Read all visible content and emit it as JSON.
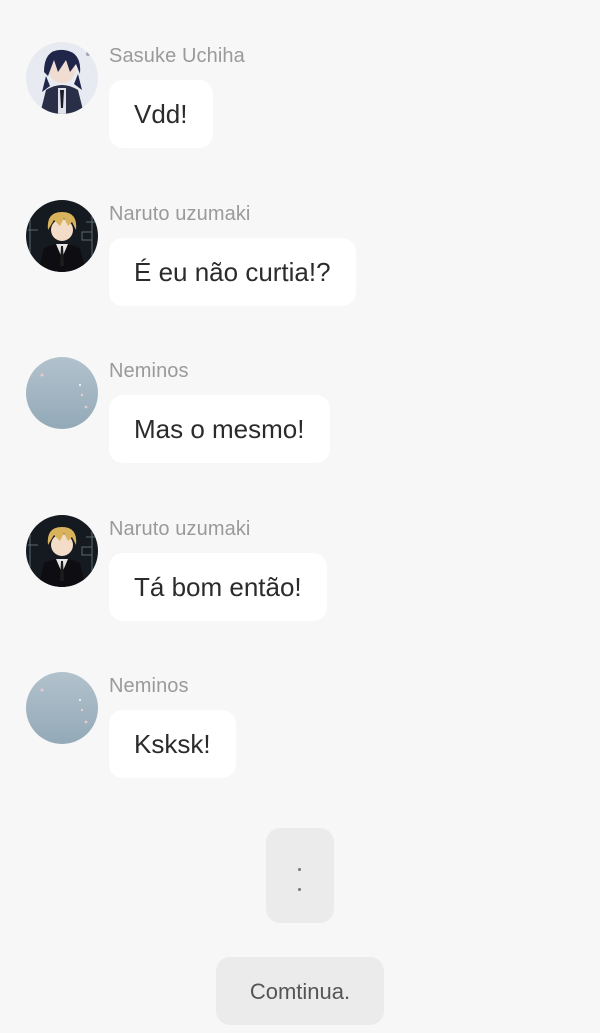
{
  "messages": [
    {
      "author": "Sasuke Uchiha",
      "text": "Vdd!",
      "avatar": "sasuke-avatar"
    },
    {
      "author": "Naruto uzumaki",
      "text": "É eu não curtia!?",
      "avatar": "naruto-avatar"
    },
    {
      "author": "Neminos",
      "text": "Mas o mesmo!",
      "avatar": "neminos-avatar"
    },
    {
      "author": "Naruto uzumaki",
      "text": "Tá bom então!",
      "avatar": "naruto-avatar"
    },
    {
      "author": "Neminos",
      "text": "Ksksk!",
      "avatar": "neminos-avatar"
    }
  ],
  "ellipsis": {
    "dot1": ".",
    "dot2": "."
  },
  "continue_button": {
    "label": "Comtinua."
  },
  "colors": {
    "background": "#f7f7f7",
    "bubble": "#ffffff",
    "name_text": "#9a9a9a",
    "message_text": "#2b2b2b",
    "neutral_box": "#ebebeb"
  }
}
